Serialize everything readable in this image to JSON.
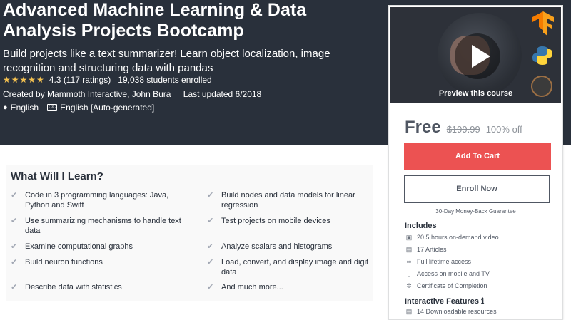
{
  "course": {
    "title": "Advanced Machine Learning & Data Analysis Projects Bootcamp",
    "subtitle": "Build projects like a text summarizer! Learn object localization, image recognition and structuring data with pandas",
    "stars": "★★★★★",
    "rating": "4.3 (117 ratings)",
    "enrolled": "19,038 students enrolled",
    "created_by": "Created by Mammoth Interactive, John Bura",
    "last_updated": "Last updated 6/2018",
    "language": "English",
    "captions": "English [Auto-generated]",
    "cc_icon_text": "CC"
  },
  "sidebar": {
    "preview_label": "Preview this course",
    "price": "Free",
    "original_price": "$199.99",
    "discount": "100% off",
    "add_to_cart": "Add To Cart",
    "enroll_now": "Enroll Now",
    "guarantee": "30-Day Money-Back Guarantee",
    "includes_title": "Includes",
    "includes": [
      {
        "icon": "video-icon",
        "label": "20.5 hours on-demand video"
      },
      {
        "icon": "article-icon",
        "label": "17 Articles"
      },
      {
        "icon": "infinity-icon",
        "label": "Full lifetime access"
      },
      {
        "icon": "mobile-icon",
        "label": "Access on mobile and TV"
      },
      {
        "icon": "certificate-icon",
        "label": "Certificate of Completion"
      }
    ],
    "interactive_title": "Interactive Features",
    "interactive_info": "ℹ",
    "interactive": [
      {
        "icon": "download-icon",
        "label": "14 Downloadable resources"
      }
    ]
  },
  "learn": {
    "title": "What Will I Learn?",
    "left": [
      "Code in 3 programming languages: Java, Python and Swift",
      "Use summarizing mechanisms to handle text data",
      "Examine computational graphs",
      "Build neuron functions",
      "Describe data with statistics"
    ],
    "right": [
      "Build nodes and data models for linear regression",
      "Test projects on mobile devices",
      "Analyze scalars and histograms",
      "Load, convert, and display image and digit data",
      "And much more..."
    ]
  },
  "colors": {
    "hero_bg": "#29303b",
    "star": "#f4c150",
    "cart_button": "#ec5252"
  }
}
